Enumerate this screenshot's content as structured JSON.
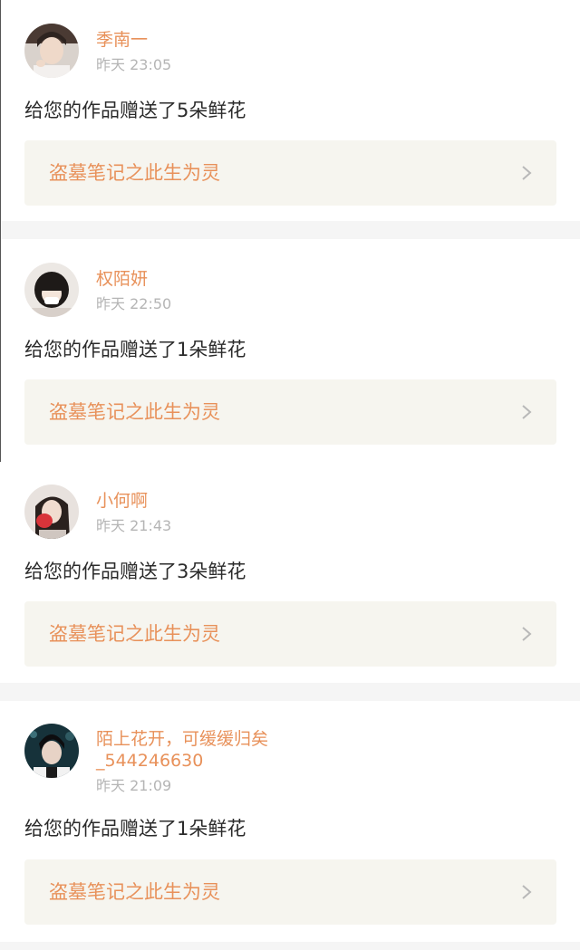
{
  "colors": {
    "accent": "#e8915a",
    "page_background": "#f5f5f5",
    "card_background": "#ffffff",
    "link_background": "#f6f5ef",
    "timestamp": "#b5b5b5",
    "message_text": "#2b2b2b"
  },
  "notifications": [
    {
      "username": "季南一",
      "timestamp": "昨天 23:05",
      "message": "给您的作品赠送了5朵鲜花",
      "work_title": "盗墓笔记之此生为灵",
      "avatar_icon": "avatar-photo"
    },
    {
      "username": "权陌妍",
      "timestamp": "昨天 22:50",
      "message": "给您的作品赠送了1朵鲜花",
      "work_title": "盗墓笔记之此生为灵",
      "avatar_icon": "avatar-photo"
    },
    {
      "username": "小何啊",
      "timestamp": "昨天 21:43",
      "message": "给您的作品赠送了3朵鲜花",
      "work_title": "盗墓笔记之此生为灵",
      "avatar_icon": "avatar-photo"
    },
    {
      "username_line1": "陌上花开，可缓缓归矣",
      "username_line2": "_544246630",
      "timestamp": "昨天 21:09",
      "message": "给您的作品赠送了1朵鲜花",
      "work_title": "盗墓笔记之此生为灵",
      "avatar_icon": "avatar-photo"
    }
  ]
}
